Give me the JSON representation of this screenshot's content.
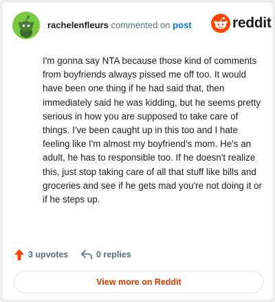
{
  "comment": {
    "author": "rachelenfleurs",
    "action_text": "commented on",
    "target_link": "post",
    "body": "I'm gonna say NTA because those kind of comments from boyfriends always pissed me off too. It would have been one thing if he had said that, then immediately said he was kidding, but he seems pretty serious in how you are supposed to take care of things. I've been caught up in this too and I hate feeling like I'm almost my boyfriend's mom. He's an adult, he has to responsible too. If he doesn't realize this, just stop taking care of all that stuff like bills and groceries and see if he gets mad you're not doing it or if he steps up.",
    "upvotes_label": "3 upvotes",
    "replies_label": "0 replies"
  },
  "brand": {
    "name": "reddit",
    "color": "#ff4500"
  },
  "cta": {
    "label": "View more on Reddit",
    "color": "#d93a00"
  },
  "icons": {
    "avatar": "snoo-avatar-icon",
    "logo": "reddit-logo-icon",
    "upvote": "upvote-arrow-icon",
    "reply": "reply-arrow-icon"
  },
  "colors": {
    "avatar_bg": "#7ac943",
    "upvote": "#ff4500",
    "link": "#0079d3"
  }
}
